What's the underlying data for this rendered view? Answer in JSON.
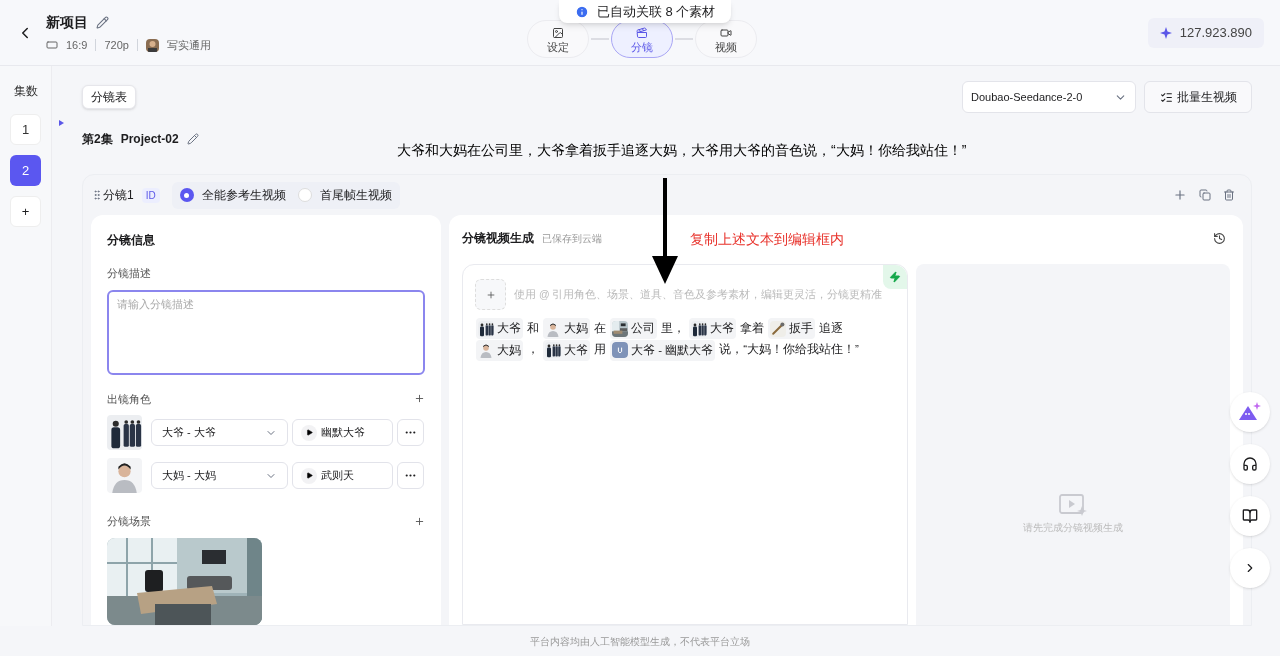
{
  "header": {
    "title": "新项目",
    "meta": [
      {
        "kind": "ratio",
        "text": "16:9"
      },
      {
        "kind": "resolution",
        "text": "720p"
      },
      {
        "kind": "style",
        "text": "写实通用"
      }
    ],
    "steps": [
      {
        "label": "设定",
        "selected": false
      },
      {
        "label": "分镜",
        "selected": true
      },
      {
        "label": "视频",
        "selected": false
      }
    ],
    "credits": "127.923.890"
  },
  "toast": "已自动关联 8 个素材",
  "episodes": {
    "label": "集数",
    "items": [
      {
        "label": "1",
        "selected": false
      },
      {
        "label": "2",
        "selected": true
      }
    ],
    "add": "+"
  },
  "toolbar": {
    "table_button": "分镜表",
    "model": "Doubao-Seedance-2-0",
    "batch_button": "批量生视频"
  },
  "episode_title": {
    "number": "第2集",
    "name": "Project-02"
  },
  "annotations": {
    "prompt": "大爷和大妈在公司里，大爷拿着扳手追逐大妈，大爷用大爷的音色说，“大妈！你给我站住！”",
    "instruction": "复制上述文本到编辑框内"
  },
  "shot": {
    "label": "分镜1",
    "badge": "ID",
    "modes": [
      {
        "label": "全能参考生视频",
        "selected": true
      },
      {
        "label": "首尾帧生视频",
        "selected": false
      }
    ],
    "info": {
      "title": "分镜信息",
      "description_label": "分镜描述",
      "description_placeholder": "请输入分镜描述",
      "roles_label": "出镜角色",
      "roles": [
        {
          "kind": "group",
          "name": "大爷 - 大爷",
          "voice": "幽默大爷"
        },
        {
          "kind": "single",
          "name": "大妈 - 大妈",
          "voice": "武则天"
        }
      ],
      "scene_label": "分镜场景"
    },
    "generation": {
      "title": "分镜视频生成",
      "status": "已保存到云端",
      "placeholder": "使用 @ 引用角色、场景、道具、音色及参考素材，编辑更灵活，分镜更精准",
      "content": [
        {
          "kind": "group",
          "text": "大爷"
        },
        {
          "kind": "text",
          "text": "和"
        },
        {
          "kind": "single",
          "text": "大妈"
        },
        {
          "kind": "text",
          "text": "在"
        },
        {
          "kind": "scene",
          "text": "公司"
        },
        {
          "kind": "text",
          "text": "里，"
        },
        {
          "kind": "group",
          "text": "大爷"
        },
        {
          "kind": "text",
          "text": "拿着"
        },
        {
          "kind": "prop",
          "text": "扳手"
        },
        {
          "kind": "text",
          "text": "追逐"
        },
        {
          "kind": "single",
          "text": "大妈"
        },
        {
          "kind": "text",
          "text": "，"
        },
        {
          "kind": "group",
          "text": "大爷"
        },
        {
          "kind": "text",
          "text": "用"
        },
        {
          "kind": "voice",
          "text": "大爷 - 幽默大爷"
        },
        {
          "kind": "text",
          "text": "说，“大妈！你给我站住！”"
        }
      ],
      "empty_text": "请先完成分镜视频生成"
    }
  },
  "footer": "平台内容均由人工智能模型生成，不代表平台立场"
}
